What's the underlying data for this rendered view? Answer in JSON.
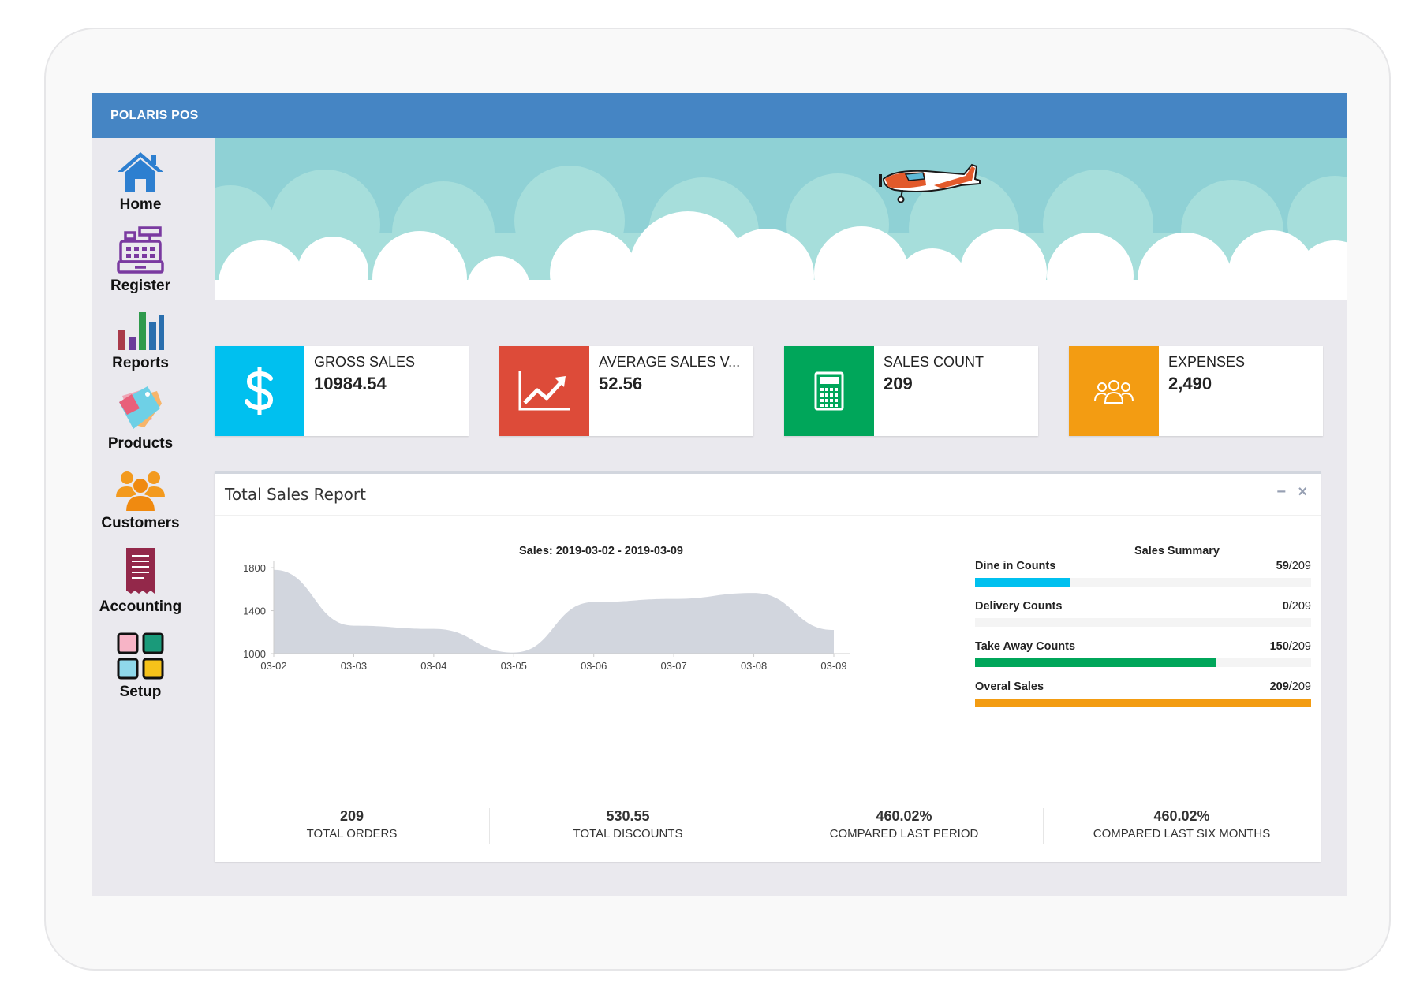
{
  "app": {
    "title": "POLARIS POS"
  },
  "sidebar": {
    "items": [
      {
        "label": "Home",
        "icon": "home-icon"
      },
      {
        "label": "Register",
        "icon": "cash-register-icon"
      },
      {
        "label": "Reports",
        "icon": "bar-chart-icon"
      },
      {
        "label": "Products",
        "icon": "price-tags-icon"
      },
      {
        "label": "Customers",
        "icon": "users-group-icon"
      },
      {
        "label": "Accounting",
        "icon": "receipt-icon"
      },
      {
        "label": "Setup",
        "icon": "grid-tiles-icon"
      }
    ]
  },
  "cards": [
    {
      "label": "GROSS SALES",
      "value": "10984.54",
      "color": "#00c0ef",
      "icon": "dollar-icon"
    },
    {
      "label": "AVERAGE SALES V...",
      "value": "52.56",
      "color": "#dd4b39",
      "icon": "trend-up-icon"
    },
    {
      "label": "SALES COUNT",
      "value": "209",
      "color": "#00a65a",
      "icon": "calculator-icon"
    },
    {
      "label": "EXPENSES",
      "value": "2,490",
      "color": "#f39c12",
      "icon": "people-icon"
    }
  ],
  "panel": {
    "title": "Total Sales Report",
    "minimize": "−",
    "close": "×"
  },
  "chart_data": {
    "type": "area",
    "title": "Sales: 2019-03-02 - 2019-03-09",
    "categories": [
      "03-02",
      "03-03",
      "03-04",
      "03-05",
      "03-06",
      "03-07",
      "03-08",
      "03-09"
    ],
    "series": [
      {
        "values": [
          1780,
          1260,
          1230,
          1010,
          1480,
          1510,
          1565,
          1220
        ],
        "color": "#d2d6de"
      }
    ],
    "yticks": [
      1000,
      1400,
      1800
    ],
    "ylim": [
      1000,
      1830
    ],
    "xlabel": "",
    "ylabel": "",
    "grid": false
  },
  "summary": {
    "title": "Sales Summary",
    "items": [
      {
        "label": "Dine in Counts",
        "count": "59",
        "total": "/209",
        "value": 59,
        "max": 209,
        "color": "#00c0ef"
      },
      {
        "label": "Delivery Counts",
        "count": "0",
        "total": "/209",
        "value": 0,
        "max": 209,
        "color": "#dd4b39"
      },
      {
        "label": "Take Away Counts",
        "count": "150",
        "total": "/209",
        "value": 150,
        "max": 209,
        "color": "#00a65a"
      },
      {
        "label": "Overal Sales",
        "count": "209",
        "total": "/209",
        "value": 209,
        "max": 209,
        "color": "#f39c12"
      }
    ]
  },
  "stats": [
    {
      "value": "209",
      "label": "TOTAL ORDERS"
    },
    {
      "value": "530.55",
      "label": "TOTAL DISCOUNTS"
    },
    {
      "value": "460.02%",
      "label": "COMPARED LAST PERIOD"
    },
    {
      "value": "460.02%",
      "label": "COMPARED LAST SIX MONTHS"
    }
  ]
}
